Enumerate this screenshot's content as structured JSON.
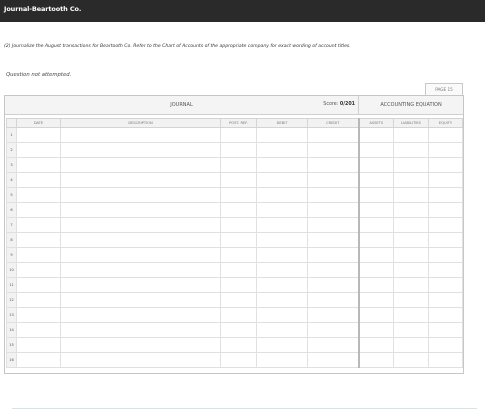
{
  "window": {
    "title": "Journal-Beartooth Co."
  },
  "instructions": "(2) Journalize the August transactions for Beartooth Co. Refer to the Chart of Accounts of the appropriate company for exact wording of account titles.",
  "status_text": "Question not attempted.",
  "page_tab": "PAGE 15",
  "journal": {
    "title": "JOURNAL",
    "score_label": "Score:",
    "score_value": "0/201",
    "equation_title": "ACCOUNTING EQUATION",
    "columns": [
      "DATE",
      "DESCRIPTION",
      "POST. REF.",
      "DEBIT",
      "CREDIT",
      "ASSETS",
      "LIABILITIES",
      "EQUITY"
    ],
    "rows": [
      "1",
      "2",
      "3",
      "4",
      "5",
      "6",
      "7",
      "8",
      "9",
      "10",
      "11",
      "12",
      "13",
      "14",
      "15",
      "16"
    ]
  }
}
